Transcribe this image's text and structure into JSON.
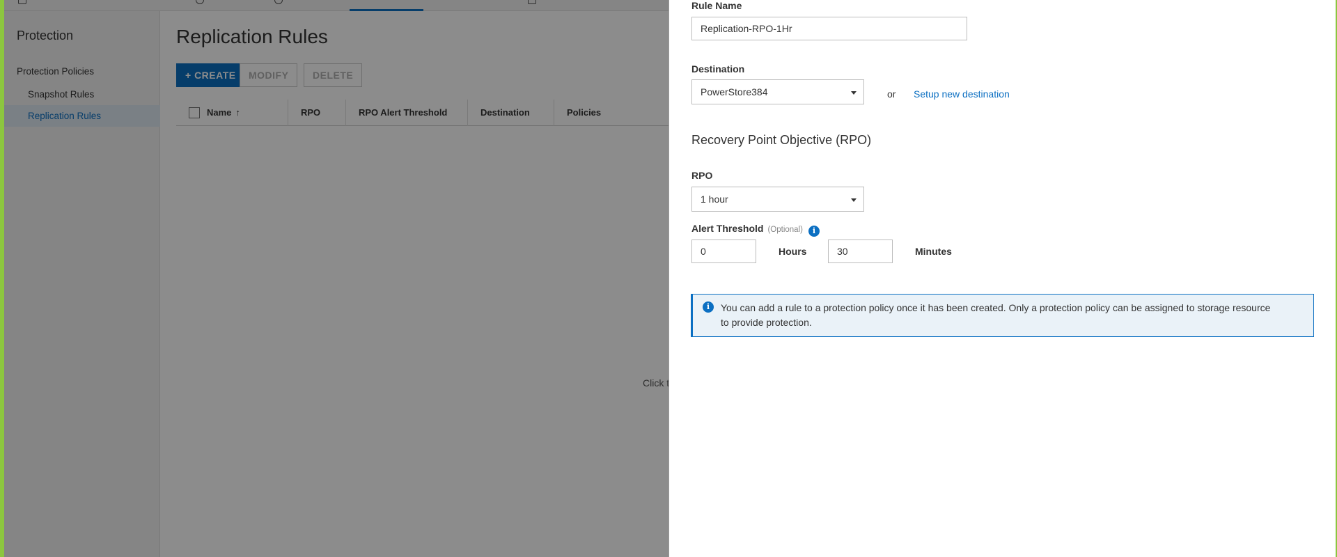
{
  "sidebar": {
    "title": "Protection",
    "group": "Protection Policies",
    "items": [
      {
        "label": "Snapshot Rules"
      },
      {
        "label": "Replication Rules"
      }
    ]
  },
  "main": {
    "title": "Replication Rules",
    "toolbar": {
      "create_label": "+ CREATE",
      "modify_label": "MODIFY",
      "delete_label": "DELETE"
    },
    "columns": [
      "Name",
      "RPO",
      "RPO Alert Threshold",
      "Destination",
      "Policies"
    ],
    "sort_glyph": "↑",
    "empty_hint": "Click t"
  },
  "panel": {
    "rule_name_label": "Rule Name",
    "rule_name_value": "Replication-RPO-1Hr",
    "destination_label": "Destination",
    "destination_value": "PowerStore384",
    "or_text": "or",
    "setup_link": "Setup new destination",
    "rpo_section_title": "Recovery Point Objective (RPO)",
    "rpo_label": "RPO",
    "rpo_value": "1 hour",
    "alert_label": "Alert Threshold",
    "alert_optional": "(Optional)",
    "alert_hours_value": "0",
    "hours_unit": "Hours",
    "alert_minutes_value": "30",
    "minutes_unit": "Minutes",
    "info_message": "You can add a rule to a protection policy once it has been created. Only a protection policy can be assigned to storage resource to provide protection."
  },
  "colors": {
    "accent": "#0b6fc2",
    "frame": "#8cc63f"
  }
}
